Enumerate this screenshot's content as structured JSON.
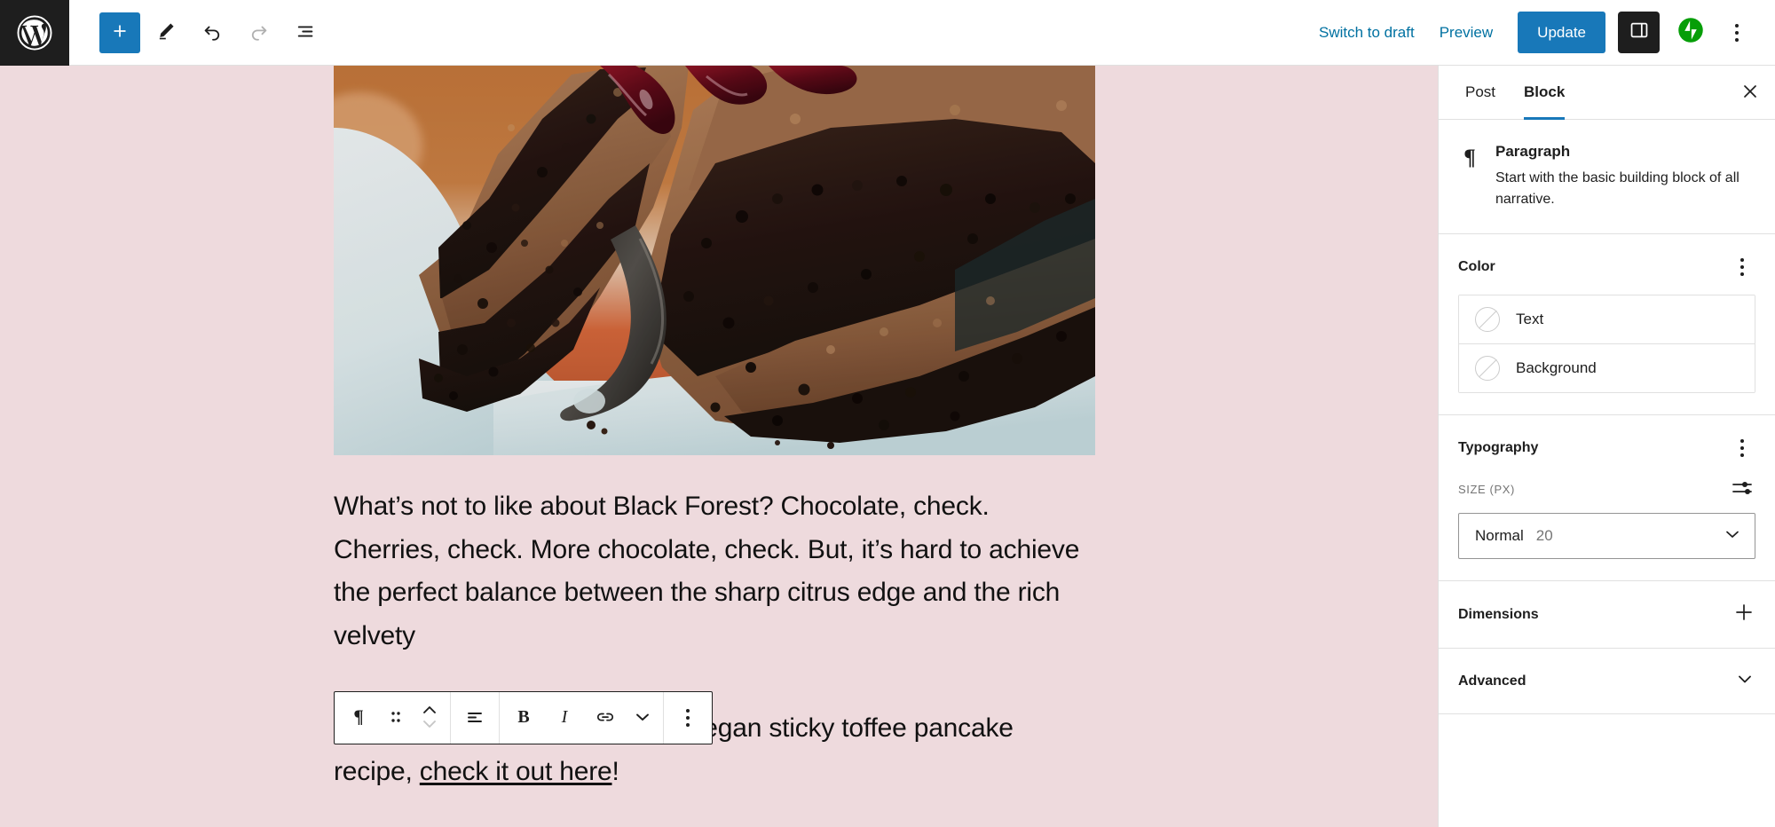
{
  "app": {
    "name": "WordPress Block Editor",
    "logo_icon": "wordpress-logo-icon"
  },
  "toolbar": {
    "left_buttons": [
      {
        "name": "block-inserter-button",
        "icon": "plus-icon",
        "label": "Add block"
      },
      {
        "name": "tools-button",
        "icon": "pencil-icon",
        "label": "Tools"
      },
      {
        "name": "undo-button",
        "icon": "undo-arrow-icon",
        "label": "Undo"
      },
      {
        "name": "redo-button",
        "icon": "redo-arrow-icon",
        "label": "Redo"
      },
      {
        "name": "list-view-button",
        "icon": "list-view-icon",
        "label": "List View"
      }
    ],
    "switch_to_draft_label": "Switch to draft",
    "preview_label": "Preview",
    "update_label": "Update",
    "settings_toggle_icon": "sidebar-panel-icon",
    "jetpack_icon": "jetpack-icon",
    "more_options_icon": "vertical-dots-icon",
    "accent_blue": "#1878b9",
    "link_blue": "#0071a1",
    "jetpack_green": "#069e08"
  },
  "canvas": {
    "background_color": "#eedadd",
    "featured_image_alt": "Slice of black forest chocolate cake on a white plate with cherry sauce",
    "paragraph_one": "What’s not to like about Black Forest? Chocolate, check. Cherries, check. More chocolate, check. But, it’s hard to achieve the perfect balance between the sharp citrus edge and the rich velvety",
    "paragraph_two_prefix": "If you haven't checked out our vegan sticky toffee pancake recipe, ",
    "paragraph_two_link": "check it out here",
    "paragraph_two_suffix": "!"
  },
  "block_toolbar": {
    "buttons": [
      {
        "name": "block-type-paragraph-button",
        "icon": "paragraph-pilcrow-icon",
        "label": "Paragraph"
      },
      {
        "name": "drag-handle-button",
        "icon": "drag-dots-icon",
        "label": "Drag"
      },
      {
        "name": "move-up-down-button",
        "icon": "move-up-down-chevrons-icon",
        "label": "Move up or down"
      },
      {
        "name": "align-text-button",
        "icon": "align-left-icon",
        "label": "Align text"
      },
      {
        "name": "bold-button",
        "icon": "bold-icon",
        "label": "Bold"
      },
      {
        "name": "italic-button",
        "icon": "italic-icon",
        "label": "Italic"
      },
      {
        "name": "link-button",
        "icon": "link-icon",
        "label": "Link"
      },
      {
        "name": "more-formatting-button",
        "icon": "chevron-down-icon",
        "label": "More rich text controls"
      },
      {
        "name": "block-options-button",
        "icon": "vertical-dots-icon",
        "label": "Options"
      }
    ]
  },
  "sidebar": {
    "tabs": [
      {
        "label": "Post",
        "active": false
      },
      {
        "label": "Block",
        "active": true
      }
    ],
    "close_icon": "close-x-icon",
    "block_card": {
      "icon": "paragraph-pilcrow-icon",
      "title": "Paragraph",
      "description": "Start with the basic building block of all narrative."
    },
    "color_section": {
      "title": "Color",
      "menu_icon": "vertical-dots-icon",
      "rows": [
        {
          "label": "Text",
          "swatch": "none"
        },
        {
          "label": "Background",
          "swatch": "none"
        }
      ]
    },
    "typography_section": {
      "title": "Typography",
      "menu_icon": "vertical-dots-icon",
      "size_label": "SIZE",
      "size_unit": "(PX)",
      "controls_icon": "sliders-icon",
      "font_size_name": "Normal",
      "font_size_value": "20",
      "chevron_icon": "chevron-down-icon"
    },
    "dimensions_section": {
      "title": "Dimensions",
      "toggle_icon": "plus-icon"
    },
    "advanced_section": {
      "title": "Advanced",
      "toggle_icon": "chevron-down-icon"
    }
  }
}
